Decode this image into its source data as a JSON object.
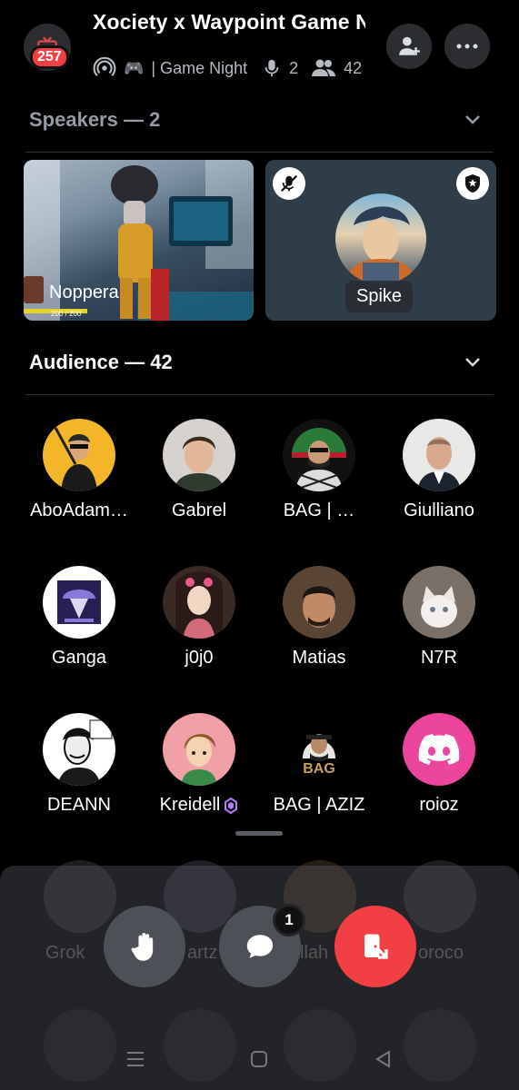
{
  "header": {
    "title": "Xociety x Waypoint Game Night",
    "notification_count": "257",
    "channel_emoji": "🎮",
    "channel_name": "| Game Night",
    "speaker_count": "2",
    "listener_count": "42"
  },
  "speakers": {
    "title": "Speakers — 2",
    "tiles": [
      {
        "name": "Noppera",
        "hud_text": "200 / 200"
      },
      {
        "name": "Spike"
      }
    ]
  },
  "audience": {
    "title": "Audience — 42",
    "members": [
      {
        "name": "AboAdam…"
      },
      {
        "name": "Gabrel"
      },
      {
        "name": "BAG | …"
      },
      {
        "name": "Giulliano"
      },
      {
        "name": "Ganga"
      },
      {
        "name": "j0j0"
      },
      {
        "name": "Matias"
      },
      {
        "name": "N7R"
      },
      {
        "name": "DEANN"
      },
      {
        "name": "Kreidell"
      },
      {
        "name": "BAG | AZIZ"
      },
      {
        "name": "roioz"
      }
    ],
    "hidden_names": [
      "Grok",
      "artz",
      "llah",
      "oroco"
    ]
  },
  "controls": {
    "chat_unread": "1"
  },
  "colors": {
    "background": "#000000",
    "panel": "#232428",
    "leave_red": "#f23f43",
    "discord_pink": "#eb459e",
    "button_gray": "#4e5058"
  },
  "icons": [
    "tv-icon",
    "stage-icon",
    "mic-icon",
    "people-icon",
    "invite-icon",
    "more-icon",
    "chevron-down-icon",
    "mute-icon",
    "moderator-icon",
    "nitro-gem-icon",
    "discord-logo-icon",
    "raise-hand-icon",
    "chat-icon",
    "leave-icon",
    "menu-nav-icon",
    "home-nav-icon",
    "back-nav-icon"
  ]
}
